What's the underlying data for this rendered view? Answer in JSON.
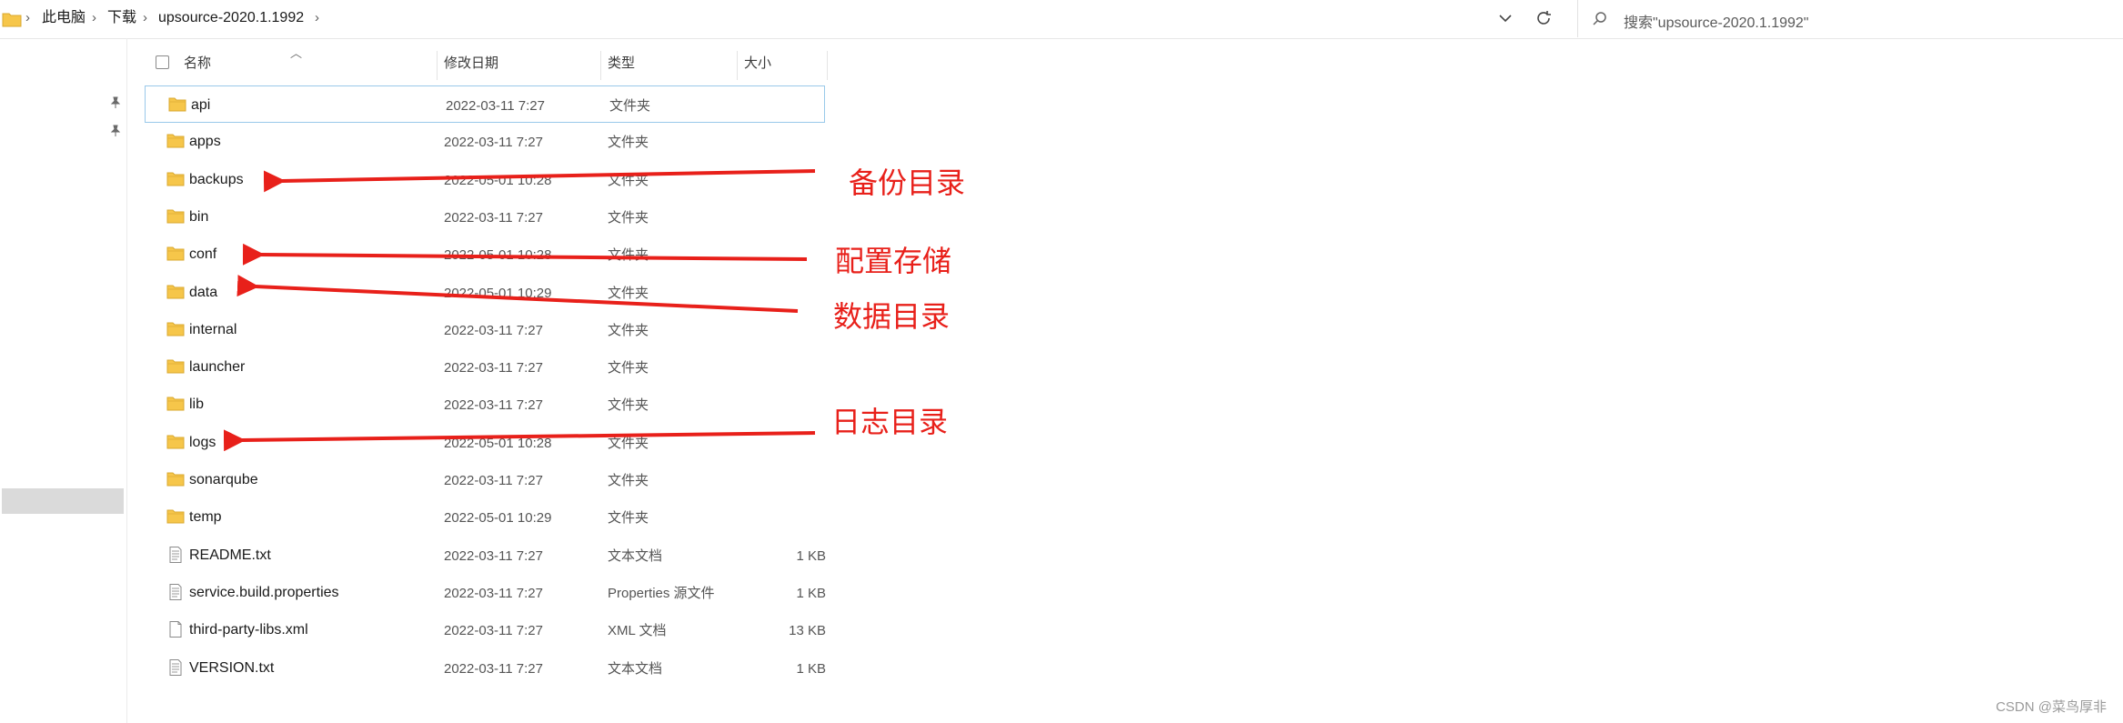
{
  "address_bar": {
    "breadcrumbs": [
      "此电脑",
      "下载",
      "upsource-2020.1.1992"
    ],
    "separator": "›"
  },
  "search": {
    "placeholder": "搜索\"upsource-2020.1.1992\""
  },
  "columns": {
    "name": "名称",
    "modified": "修改日期",
    "type": "类型",
    "size": "大小"
  },
  "files": [
    {
      "name": "api",
      "modified": "2022-03-11 7:27",
      "type": "文件夹",
      "size": "",
      "icon": "folder-icon"
    },
    {
      "name": "apps",
      "modified": "2022-03-11 7:27",
      "type": "文件夹",
      "size": "",
      "icon": "folder-icon"
    },
    {
      "name": "backups",
      "modified": "2022-05-01 10:28",
      "type": "文件夹",
      "size": "",
      "icon": "folder-icon"
    },
    {
      "name": "bin",
      "modified": "2022-03-11 7:27",
      "type": "文件夹",
      "size": "",
      "icon": "folder-icon"
    },
    {
      "name": "conf",
      "modified": "2022-05-01 10:28",
      "type": "文件夹",
      "size": "",
      "icon": "folder-icon"
    },
    {
      "name": "data",
      "modified": "2022-05-01 10:29",
      "type": "文件夹",
      "size": "",
      "icon": "folder-icon"
    },
    {
      "name": "internal",
      "modified": "2022-03-11 7:27",
      "type": "文件夹",
      "size": "",
      "icon": "folder-icon"
    },
    {
      "name": "launcher",
      "modified": "2022-03-11 7:27",
      "type": "文件夹",
      "size": "",
      "icon": "folder-icon"
    },
    {
      "name": "lib",
      "modified": "2022-03-11 7:27",
      "type": "文件夹",
      "size": "",
      "icon": "folder-icon"
    },
    {
      "name": "logs",
      "modified": "2022-05-01 10:28",
      "type": "文件夹",
      "size": "",
      "icon": "folder-icon"
    },
    {
      "name": "sonarqube",
      "modified": "2022-03-11 7:27",
      "type": "文件夹",
      "size": "",
      "icon": "folder-icon"
    },
    {
      "name": "temp",
      "modified": "2022-05-01 10:29",
      "type": "文件夹",
      "size": "",
      "icon": "folder-icon"
    },
    {
      "name": "README.txt",
      "modified": "2022-03-11 7:27",
      "type": "文本文档",
      "size": "1 KB",
      "icon": "text-file-icon"
    },
    {
      "name": "service.build.properties",
      "modified": "2022-03-11 7:27",
      "type": "Properties 源文件",
      "size": "1 KB",
      "icon": "text-file-icon"
    },
    {
      "name": "third-party-libs.xml",
      "modified": "2022-03-11 7:27",
      "type": "XML 文档",
      "size": "13 KB",
      "icon": "blank-file-icon"
    },
    {
      "name": "VERSION.txt",
      "modified": "2022-03-11 7:27",
      "type": "文本文档",
      "size": "1 KB",
      "icon": "text-file-icon"
    }
  ],
  "annotations": [
    {
      "label": "备份目录",
      "target": "backups"
    },
    {
      "label": "配置存储",
      "target": "conf"
    },
    {
      "label": "数据目录",
      "target": "data"
    },
    {
      "label": "日志目录",
      "target": "logs"
    }
  ],
  "watermark": "CSDN @菜鸟厚非",
  "colors": {
    "annotation": "#e8201a",
    "folder": "#f6c64a",
    "focus_border": "#99c9ea"
  }
}
